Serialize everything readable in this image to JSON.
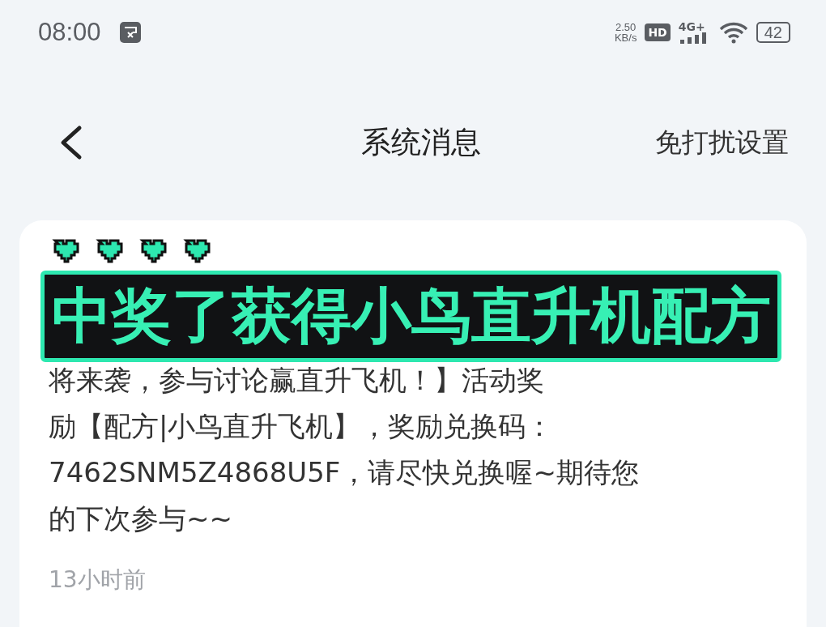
{
  "status_bar": {
    "time": "08:00",
    "speed_value": "2.50",
    "speed_unit": "KB/s",
    "hd_badge": "HD",
    "network": "4G+",
    "battery": "42"
  },
  "nav_bar": {
    "back": true,
    "title": "系统消息",
    "action": "免打扰设置"
  },
  "message": {
    "lines": [
      "将来袭，参与讨论赢直升飞机！】活动奖",
      "励【配方|小鸟直升飞机】，奖励兑换码：",
      "7462SNM5Z4868U5F，请尽快兑换喔~期待您",
      "的下次参与~~"
    ],
    "time": "13小时前"
  },
  "caption": {
    "text": "中奖了获得小鸟直升机配方"
  }
}
